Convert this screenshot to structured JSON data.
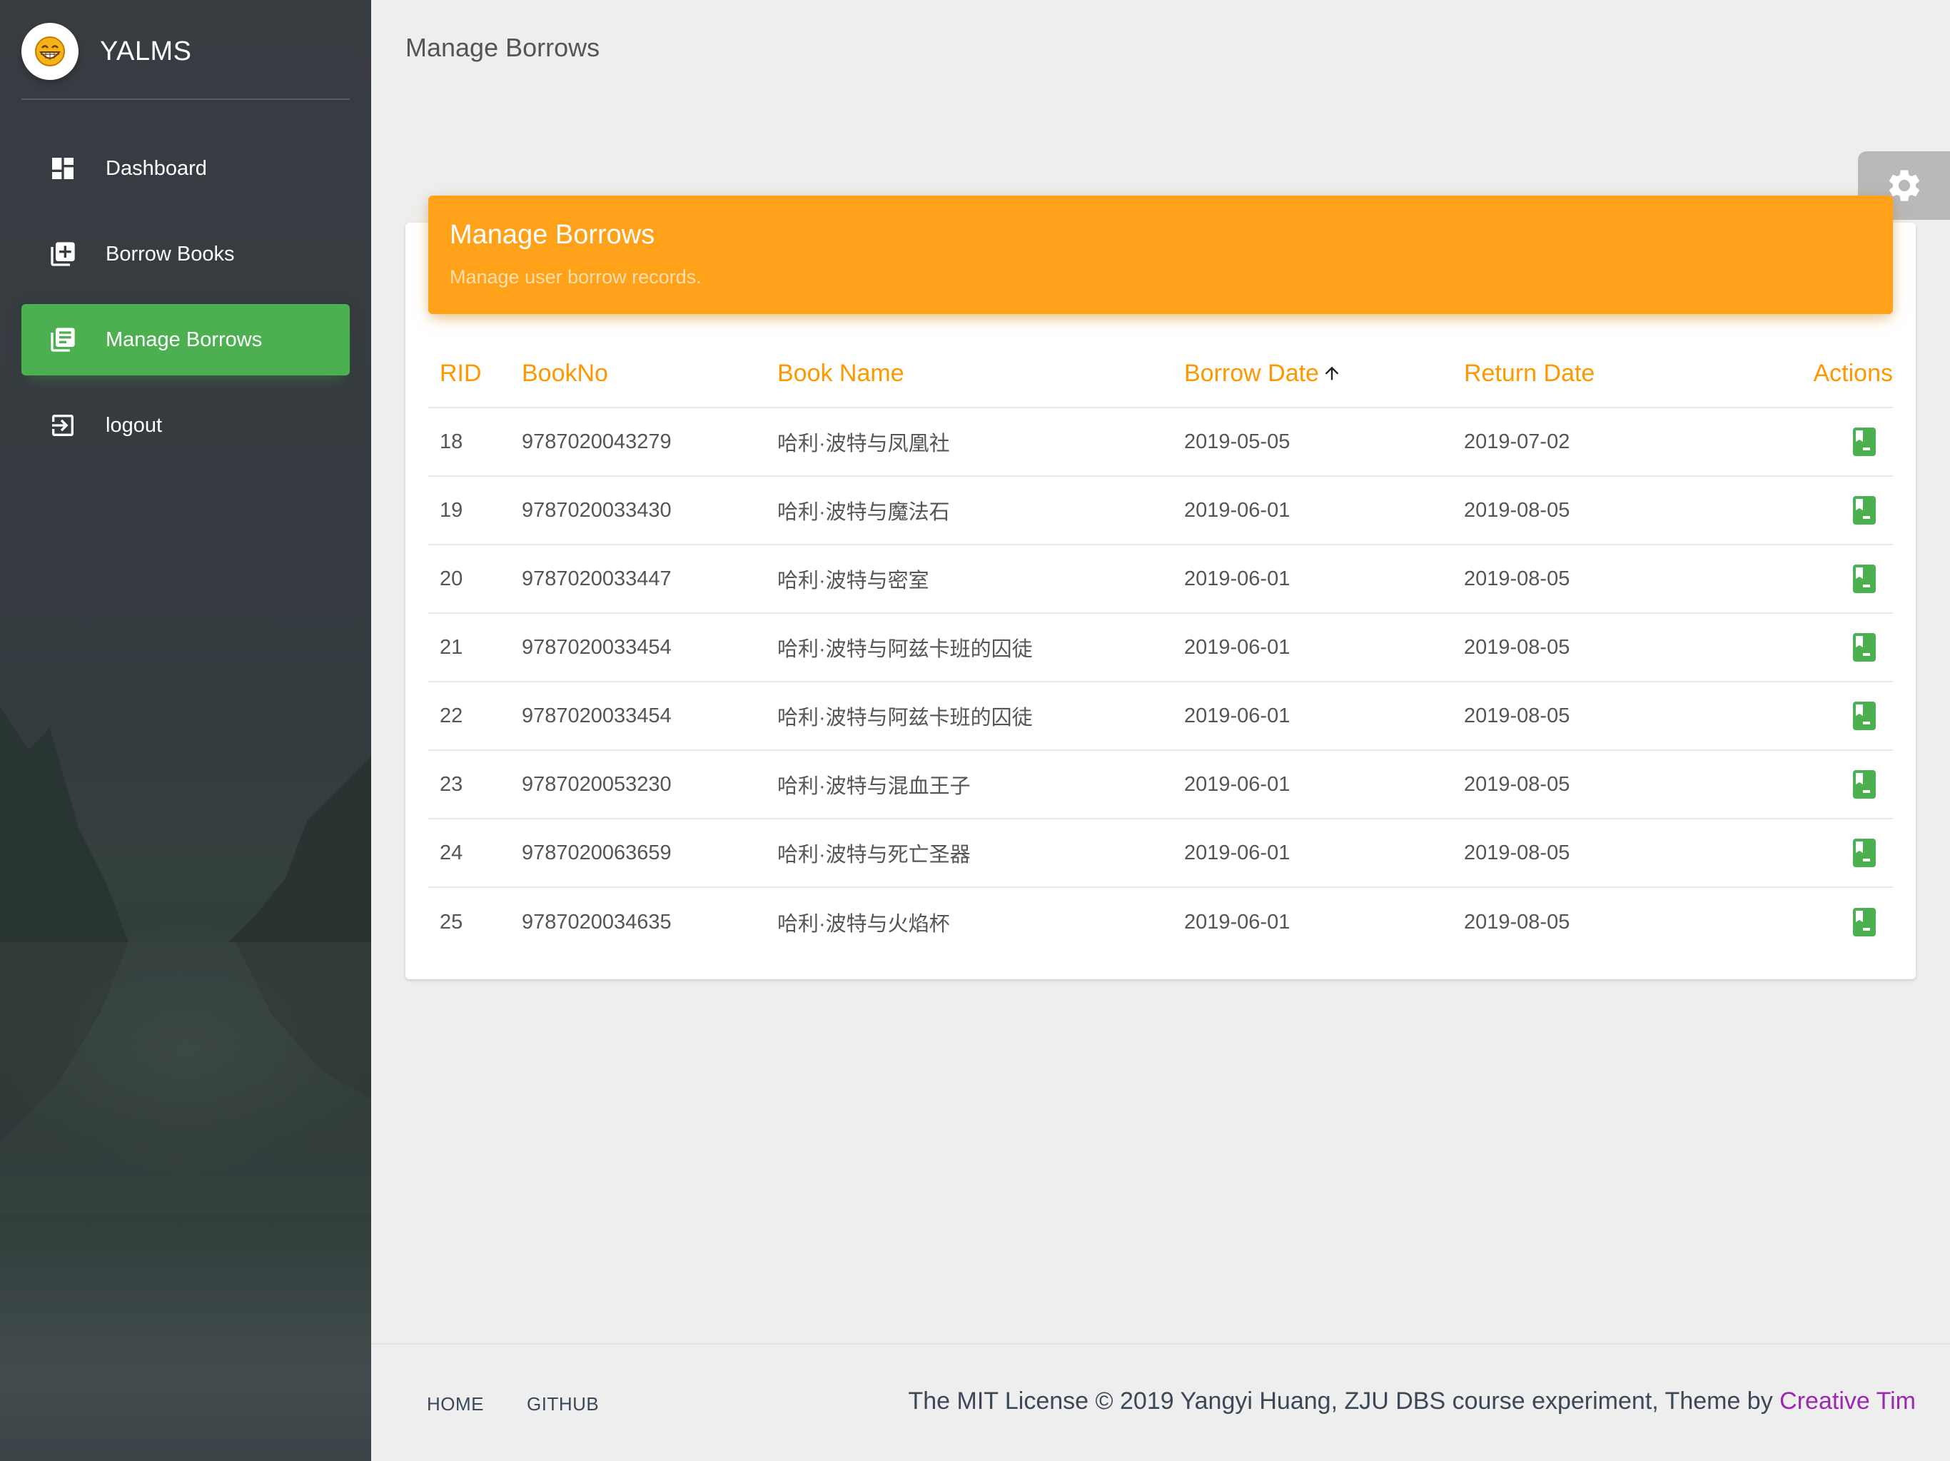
{
  "brand": {
    "name": "YALMS"
  },
  "sidebar": {
    "items": [
      {
        "label": "Dashboard",
        "icon": "dashboard-icon",
        "active": false
      },
      {
        "label": "Borrow Books",
        "icon": "library-add-icon",
        "active": false
      },
      {
        "label": "Manage Borrows",
        "icon": "library-books-icon",
        "active": true
      },
      {
        "label": "logout",
        "icon": "exit-to-app-icon",
        "active": false
      }
    ]
  },
  "page": {
    "title": "Manage Borrows"
  },
  "card": {
    "title": "Manage Borrows",
    "subtitle": "Manage user borrow records."
  },
  "table": {
    "columns": {
      "rid": "RID",
      "bookno": "BookNo",
      "name": "Book Name",
      "borrow_date": "Borrow Date",
      "return_date": "Return Date",
      "actions": "Actions"
    },
    "sort": {
      "column": "borrow_date",
      "direction": "asc",
      "icon": "arrow-upward-icon"
    },
    "rows": [
      {
        "rid": "18",
        "bookno": "9787020043279",
        "name": "哈利·波特与凤凰社",
        "borrow_date": "2019-05-05",
        "return_date": "2019-07-02"
      },
      {
        "rid": "19",
        "bookno": "9787020033430",
        "name": "哈利·波特与魔法石",
        "borrow_date": "2019-06-01",
        "return_date": "2019-08-05"
      },
      {
        "rid": "20",
        "bookno": "9787020033447",
        "name": "哈利·波特与密室",
        "borrow_date": "2019-06-01",
        "return_date": "2019-08-05"
      },
      {
        "rid": "21",
        "bookno": "9787020033454",
        "name": "哈利·波特与阿兹卡班的囚徒",
        "borrow_date": "2019-06-01",
        "return_date": "2019-08-05"
      },
      {
        "rid": "22",
        "bookno": "9787020033454",
        "name": "哈利·波特与阿兹卡班的囚徒",
        "borrow_date": "2019-06-01",
        "return_date": "2019-08-05"
      },
      {
        "rid": "23",
        "bookno": "9787020053230",
        "name": "哈利·波特与混血王子",
        "borrow_date": "2019-06-01",
        "return_date": "2019-08-05"
      },
      {
        "rid": "24",
        "bookno": "9787020063659",
        "name": "哈利·波特与死亡圣器",
        "borrow_date": "2019-06-01",
        "return_date": "2019-08-05"
      },
      {
        "rid": "25",
        "bookno": "9787020034635",
        "name": "哈利·波特与火焰杯",
        "borrow_date": "2019-06-01",
        "return_date": "2019-08-05"
      }
    ],
    "row_action_icon": "book-return-icon"
  },
  "footer": {
    "links": [
      "HOME",
      "GITHUB"
    ],
    "copyright": "The MIT License © 2019 Yangyi Huang, ZJU DBS course experiment, Theme by ",
    "theme_link": "Creative Tim"
  },
  "colors": {
    "accent_green": "#4caf50",
    "header_orange": "#ffa21a",
    "column_orange": "#ff9800",
    "link_purple": "#9c27b0"
  }
}
